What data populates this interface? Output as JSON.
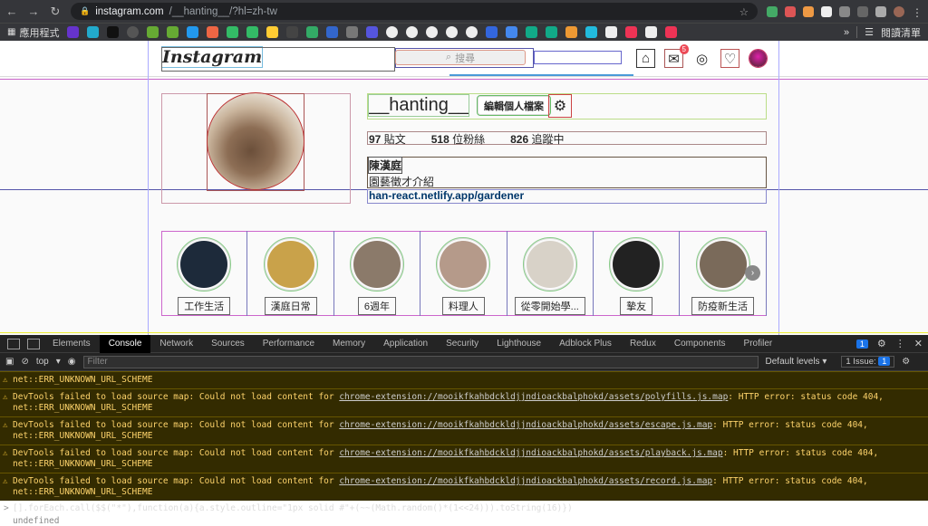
{
  "browser": {
    "url_host": "instagram.com",
    "url_path": "/__hanting__/?hl=zh-tw",
    "apps_label": "應用程式",
    "reading_list": "閱讀清單",
    "more": "»"
  },
  "header": {
    "logo": "Instagram",
    "search_placeholder": "搜尋",
    "notif_count": "5"
  },
  "profile": {
    "username": "__hanting__",
    "edit_button": "編輯個人檔案",
    "posts_count": "97",
    "posts_label": "貼文",
    "followers_count": "518",
    "followers_label": "位粉絲",
    "following_count": "826",
    "following_label": "追蹤中",
    "full_name": "陳漢庭",
    "bio": "園藝徵才介紹",
    "link": "han-react.netlify.app/gardener"
  },
  "highlights": [
    {
      "label": "工作生活",
      "color": "#1d2a3a"
    },
    {
      "label": "漢庭日常",
      "color": "#c9a24a"
    },
    {
      "label": "6週年",
      "color": "#8b7a6a"
    },
    {
      "label": "料理人",
      "color": "#b59a8a"
    },
    {
      "label": "從零開始學...",
      "color": "#d8d2c8"
    },
    {
      "label": "摯友",
      "color": "#222222"
    },
    {
      "label": "防疫新生活",
      "color": "#7a6a5a"
    }
  ],
  "devtools": {
    "tabs": [
      "Elements",
      "Console",
      "Network",
      "Sources",
      "Performance",
      "Memory",
      "Application",
      "Security",
      "Lighthouse",
      "Adblock Plus",
      "Redux",
      "Components",
      "Profiler"
    ],
    "active_tab": "Console",
    "context": "top",
    "filter_placeholder": "Filter",
    "levels": "Default levels ▾",
    "issues": "1 Issue:",
    "issues_count": "1",
    "msg_count": "1",
    "messages": [
      {
        "pre": "net::ERR_UNKNOWN_URL_SCHEME"
      },
      {
        "text": "DevTools failed to load source map: Could not load content for ",
        "url": "chrome-extension://mooikfkahbdckldjjndioackbalphokd/assets/polyfills.js.map",
        "post": ": HTTP error: status code 404, net::ERR_UNKNOWN_URL_SCHEME"
      },
      {
        "text": "DevTools failed to load source map: Could not load content for ",
        "url": "chrome-extension://mooikfkahbdckldjjndioackbalphokd/assets/escape.js.map",
        "post": ": HTTP error: status code 404, net::ERR_UNKNOWN_URL_SCHEME"
      },
      {
        "text": "DevTools failed to load source map: Could not load content for ",
        "url": "chrome-extension://mooikfkahbdckldjjndioackbalphokd/assets/playback.js.map",
        "post": ": HTTP error: status code 404, net::ERR_UNKNOWN_URL_SCHEME"
      },
      {
        "text": "DevTools failed to load source map: Could not load content for ",
        "url": "chrome-extension://mooikfkahbdckldjjndioackbalphokd/assets/record.js.map",
        "post": ": HTTP error: status code 404, net::ERR_UNKNOWN_URL_SCHEME"
      }
    ],
    "command": "[].forEach.call($$(\"*\"),function(a){a.style.outline=\"1px solid #\"+(~~(Math.random()*(1<<24))).toString(16)})",
    "result": "undefined"
  }
}
